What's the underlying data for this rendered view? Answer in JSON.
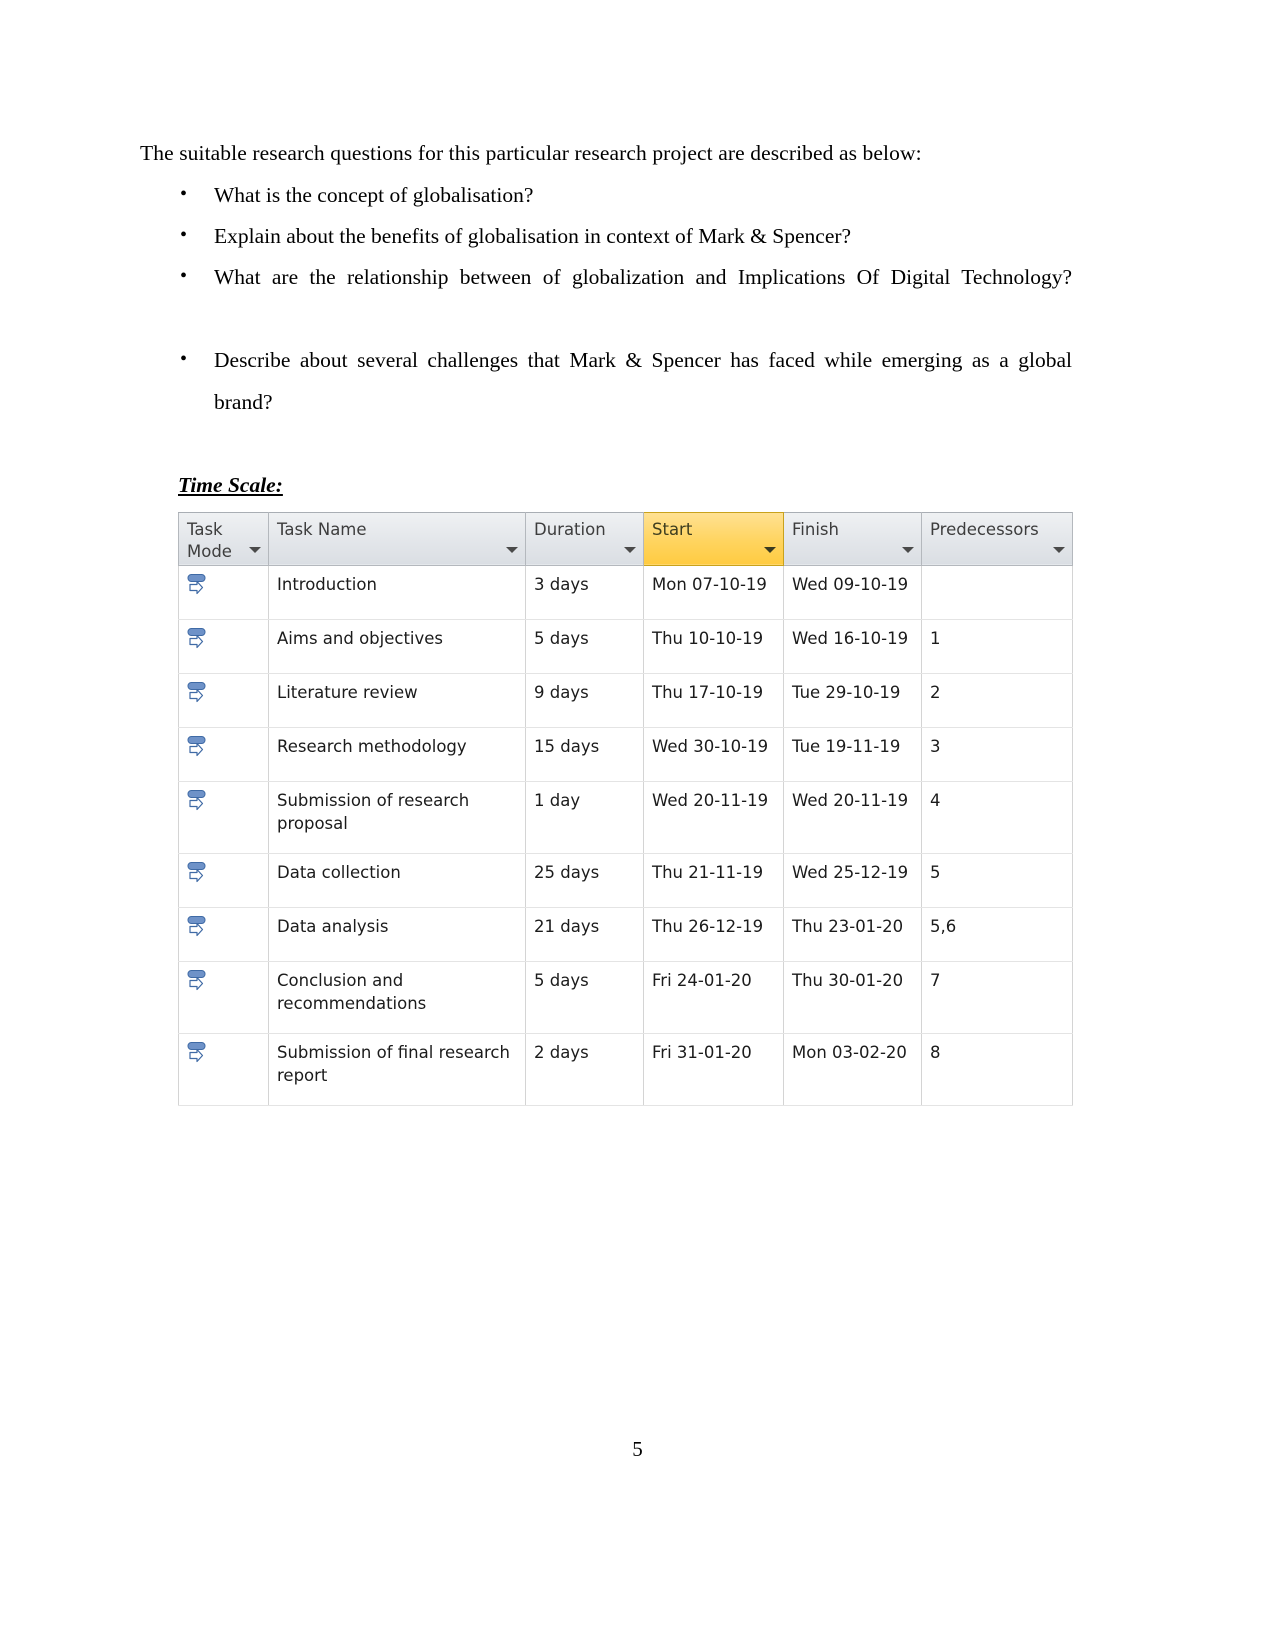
{
  "document": {
    "intro_text": "The suitable research questions for this particular research project are described as below:",
    "bullet_glyph": "•",
    "questions": [
      "What is the concept of globalisation?",
      "Explain about the benefits of globalisation in context of Mark & Spencer?",
      "What are the relationship between of globalization and Implications Of Digital Technology?",
      "Describe about several challenges that Mark & Spencer has faced while emerging as a global brand?"
    ],
    "section_heading": "Time Scale: ",
    "page_number": "5"
  },
  "colors": {
    "header_background": "#e3e6ea",
    "start_header_highlight": "#ffd45f",
    "grid_line": "#d4d4d4",
    "task_mode_icon": "#6b8fc4",
    "text": "#1b1b1b"
  },
  "project_table": {
    "columns": [
      {
        "key": "task_mode",
        "label": "Task Mode",
        "highlighted": false
      },
      {
        "key": "task_name",
        "label": "Task Name",
        "highlighted": false
      },
      {
        "key": "duration",
        "label": "Duration",
        "highlighted": false
      },
      {
        "key": "start",
        "label": "Start",
        "highlighted": true
      },
      {
        "key": "finish",
        "label": "Finish",
        "highlighted": false
      },
      {
        "key": "predecessors",
        "label": "Predecessors",
        "highlighted": false
      }
    ],
    "rows": [
      {
        "task_mode_icon": "auto-scheduled-icon",
        "task_name": "Introduction",
        "duration": "3 days",
        "start": "Mon 07-10-19",
        "finish": "Wed 09-10-19",
        "predecessors": ""
      },
      {
        "task_mode_icon": "auto-scheduled-icon",
        "task_name": "Aims and objectives",
        "duration": "5 days",
        "start": "Thu 10-10-19",
        "finish": "Wed 16-10-19",
        "predecessors": "1"
      },
      {
        "task_mode_icon": "auto-scheduled-icon",
        "task_name": "Literature review",
        "duration": "9 days",
        "start": "Thu 17-10-19",
        "finish": "Tue 29-10-19",
        "predecessors": "2"
      },
      {
        "task_mode_icon": "auto-scheduled-icon",
        "task_name": "Research methodology",
        "duration": "15 days",
        "start": "Wed 30-10-19",
        "finish": "Tue 19-11-19",
        "predecessors": "3"
      },
      {
        "task_mode_icon": "auto-scheduled-icon",
        "task_name": "Submission of research proposal",
        "duration": "1 day",
        "start": "Wed 20-11-19",
        "finish": "Wed 20-11-19",
        "predecessors": "4"
      },
      {
        "task_mode_icon": "auto-scheduled-icon",
        "task_name": "Data collection",
        "duration": "25 days",
        "start": "Thu 21-11-19",
        "finish": "Wed 25-12-19",
        "predecessors": "5"
      },
      {
        "task_mode_icon": "auto-scheduled-icon",
        "task_name": "Data analysis",
        "duration": "21 days",
        "start": "Thu 26-12-19",
        "finish": "Thu 23-01-20",
        "predecessors": "5,6"
      },
      {
        "task_mode_icon": "auto-scheduled-icon",
        "task_name": "Conclusion and recommendations",
        "duration": "5 days",
        "start": "Fri 24-01-20",
        "finish": "Thu 30-01-20",
        "predecessors": "7"
      },
      {
        "task_mode_icon": "auto-scheduled-icon",
        "task_name": "Submission of final research report",
        "duration": "2 days",
        "start": "Fri 31-01-20",
        "finish": "Mon 03-02-20",
        "predecessors": "8"
      }
    ]
  }
}
